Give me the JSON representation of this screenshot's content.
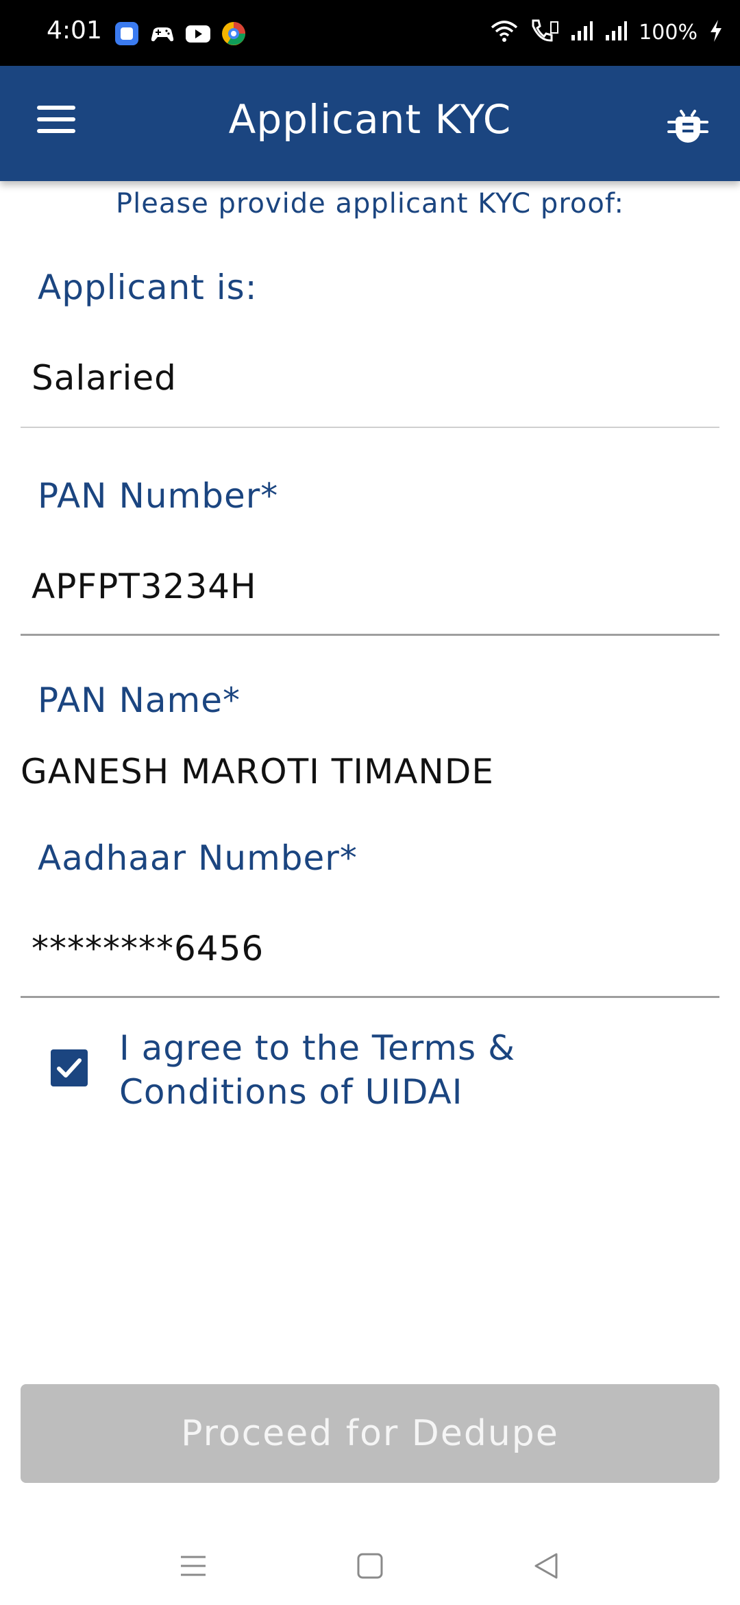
{
  "status_bar": {
    "time": "4:01",
    "battery": "100%",
    "app_icons": [
      "app-launcher-icon",
      "gamepad-icon",
      "youtube-icon",
      "browser-icon"
    ],
    "indicator_icons": [
      "wifi-icon",
      "volte-icon",
      "signal-icon",
      "signal-icon",
      "charging-icon"
    ]
  },
  "header": {
    "title": "Applicant KYC",
    "menu_icon": "hamburger-menu-icon",
    "action_icon": "bug-icon"
  },
  "form": {
    "subtitle": "Please provide applicant KYC proof:",
    "applicant_type": {
      "label": "Applicant is:",
      "value": "Salaried"
    },
    "pan_number": {
      "label": "PAN Number*",
      "value": "APFPT3234H"
    },
    "pan_name": {
      "label": "PAN Name*",
      "value": "GANESH MAROTI TIMANDE"
    },
    "aadhaar_number": {
      "label": "Aadhaar Number*",
      "value": "********6456"
    },
    "terms": {
      "checked": true,
      "line1": "I agree to the Terms &",
      "line2": "Conditions of UIDAI"
    }
  },
  "actions": {
    "proceed_label": "Proceed for Dedupe",
    "proceed_enabled": false
  },
  "nav_bar": {
    "buttons": [
      "recent-apps-icon",
      "home-icon",
      "back-icon"
    ]
  },
  "colors": {
    "primary": "#1b4580",
    "status_bar": "#000000",
    "button_disabled": "#bdbdbd",
    "divider": "#9e9e9e"
  }
}
